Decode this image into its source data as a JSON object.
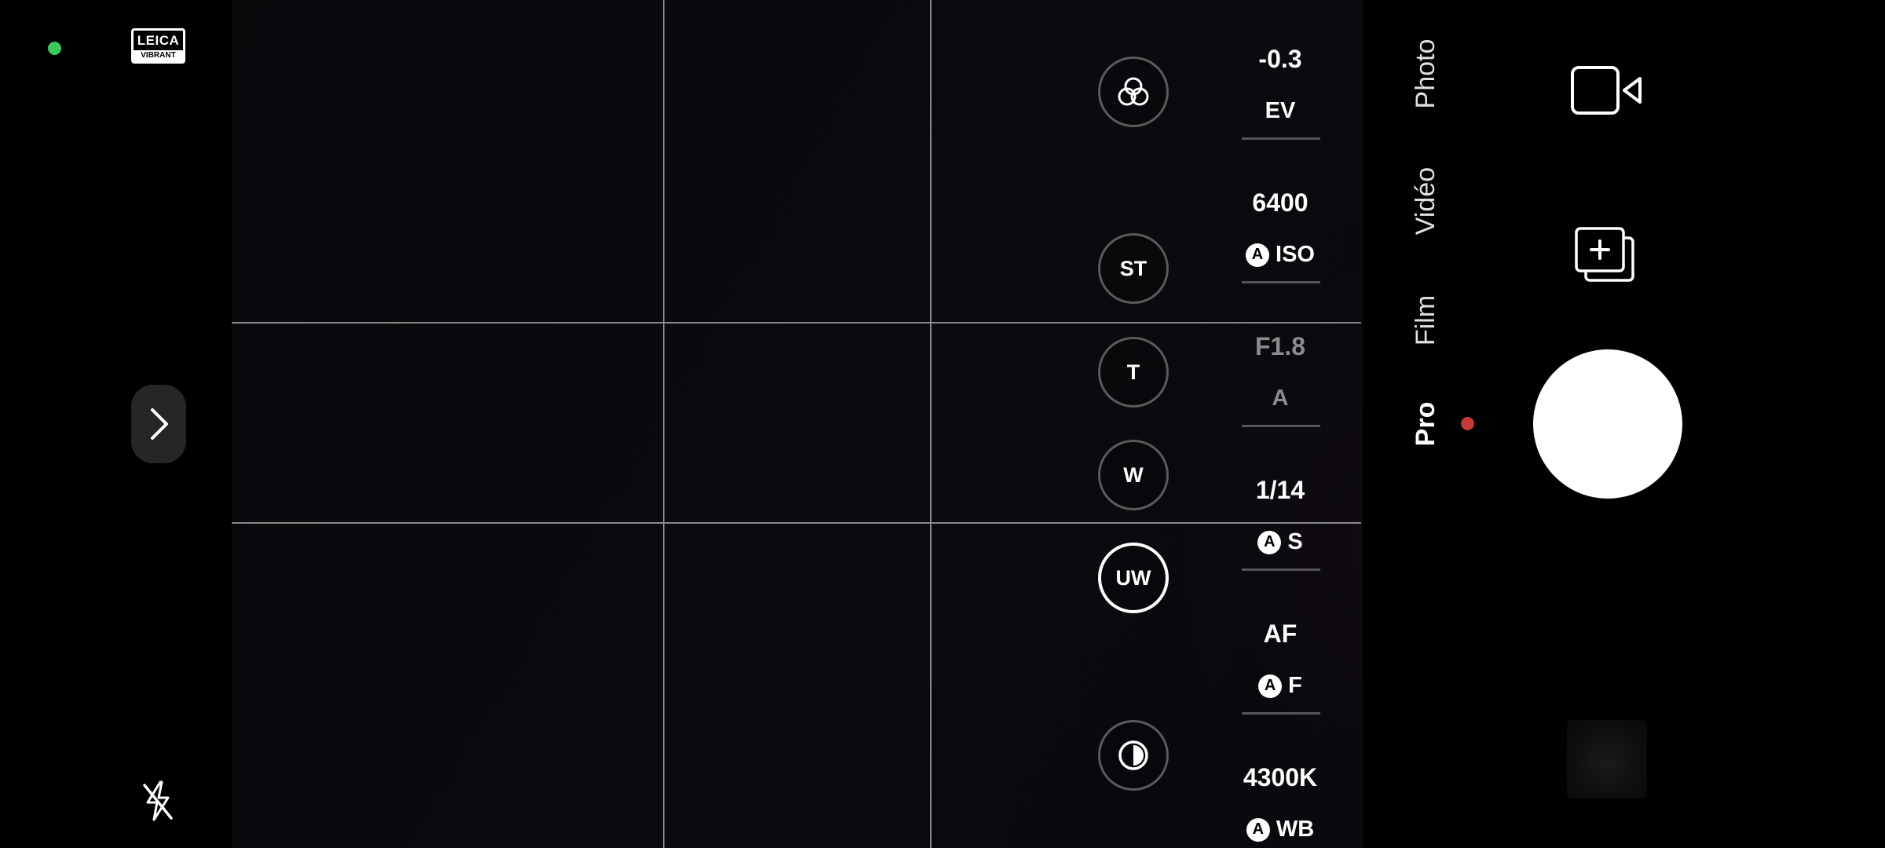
{
  "status": {
    "indicator_color": "#3ec85c"
  },
  "brand": {
    "name": "LEICA",
    "style": "VIBRANT"
  },
  "left_controls": {
    "expand_icon": "chevron-right-icon",
    "flash_icon": "flash-off-icon",
    "info_icon": "info-icon",
    "rotate_icon": "rotate-icon"
  },
  "lens_buttons": [
    {
      "id": "filters",
      "label": "",
      "icon": "color-filters-icon",
      "active": false
    },
    {
      "id": "st",
      "label": "ST",
      "active": false
    },
    {
      "id": "t",
      "label": "T",
      "active": false
    },
    {
      "id": "w",
      "label": "W",
      "active": false
    },
    {
      "id": "uw",
      "label": "UW",
      "active": true
    },
    {
      "id": "contrast",
      "label": "",
      "icon": "contrast-icon",
      "active": false
    }
  ],
  "params": {
    "ev": {
      "value": "-0.3",
      "label": "EV"
    },
    "iso": {
      "value": "6400",
      "auto": "A",
      "label": "ISO"
    },
    "aperture": {
      "value": "F1.8",
      "label": "A"
    },
    "shutter": {
      "value": "1/14",
      "auto": "A",
      "label": "S"
    },
    "focus": {
      "value": "AF",
      "auto": "A",
      "label": "F"
    },
    "wb": {
      "value": "4300K",
      "auto": "A",
      "label": "WB"
    }
  },
  "modes": [
    {
      "label": "Photo",
      "active": false
    },
    {
      "label": "Vidéo",
      "active": false
    },
    {
      "label": "Film",
      "active": false
    },
    {
      "label": "Pro",
      "active": true
    }
  ],
  "right_controls": {
    "video_icon": "video-camera-icon",
    "add_icon": "add-overlay-icon",
    "shutter": "shutter-button",
    "gallery": "gallery-thumbnail"
  },
  "colors": {
    "recording_dot": "#c43a3a",
    "accent_white": "#ffffff"
  }
}
